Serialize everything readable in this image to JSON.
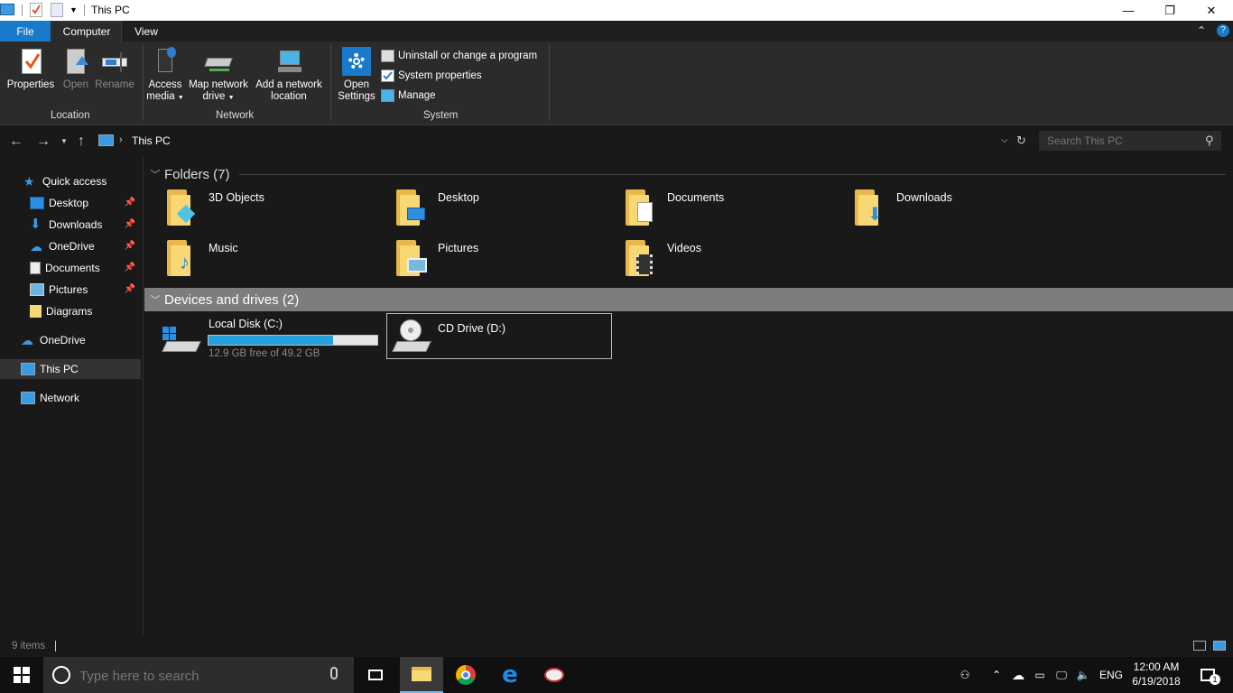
{
  "window": {
    "title": "This PC",
    "minimize": "—",
    "maximize": "❐",
    "close": "✕"
  },
  "ribbon_tabs": {
    "file": "File",
    "computer": "Computer",
    "view": "View"
  },
  "ribbon": {
    "location": {
      "label": "Location",
      "properties": "Properties",
      "open": "Open",
      "rename": "Rename"
    },
    "network": {
      "label": "Network",
      "access_media_1": "Access",
      "access_media_2": "media",
      "map_drive_1": "Map network",
      "map_drive_2": "drive",
      "add_location_1": "Add a network",
      "add_location_2": "location"
    },
    "system": {
      "label": "System",
      "open_settings_1": "Open",
      "open_settings_2": "Settings",
      "uninstall": "Uninstall or change a program",
      "sys_props": "System properties",
      "manage": "Manage"
    }
  },
  "address": {
    "path": "This PC",
    "search_placeholder": "Search This PC"
  },
  "nav": {
    "quick_access": "Quick access",
    "items": [
      {
        "label": "Desktop",
        "icon": "desktop-icon",
        "pinned": true
      },
      {
        "label": "Downloads",
        "icon": "download-icon",
        "pinned": true
      },
      {
        "label": "OneDrive",
        "icon": "cloud-icon",
        "pinned": true
      },
      {
        "label": "Documents",
        "icon": "document-icon",
        "pinned": true
      },
      {
        "label": "Pictures",
        "icon": "picture-icon",
        "pinned": true
      },
      {
        "label": "Diagrams",
        "icon": "folder-icon",
        "pinned": false
      }
    ],
    "onedrive": "OneDrive",
    "this_pc": "This PC",
    "network": "Network",
    "pin_glyph": "📌"
  },
  "folders": {
    "header": "Folders (7)",
    "items": [
      "3D Objects",
      "Desktop",
      "Documents",
      "Downloads",
      "Music",
      "Pictures",
      "Videos"
    ]
  },
  "drives": {
    "header": "Devices and drives (2)",
    "c": {
      "name": "Local Disk (C:)",
      "free": "12.9 GB free of 49.2 GB",
      "used_fraction": 0.738
    },
    "d": {
      "name": "CD Drive (D:)"
    }
  },
  "status": {
    "items": "9 items"
  },
  "taskbar": {
    "search_placeholder": "Type here to search",
    "lang": "ENG",
    "time": "12:00 AM",
    "date": "6/19/2018",
    "notifications": "1"
  },
  "colors": {
    "accent": "#1979ca",
    "bar": "#26a0da",
    "selected_group": "#7d7d7d"
  }
}
